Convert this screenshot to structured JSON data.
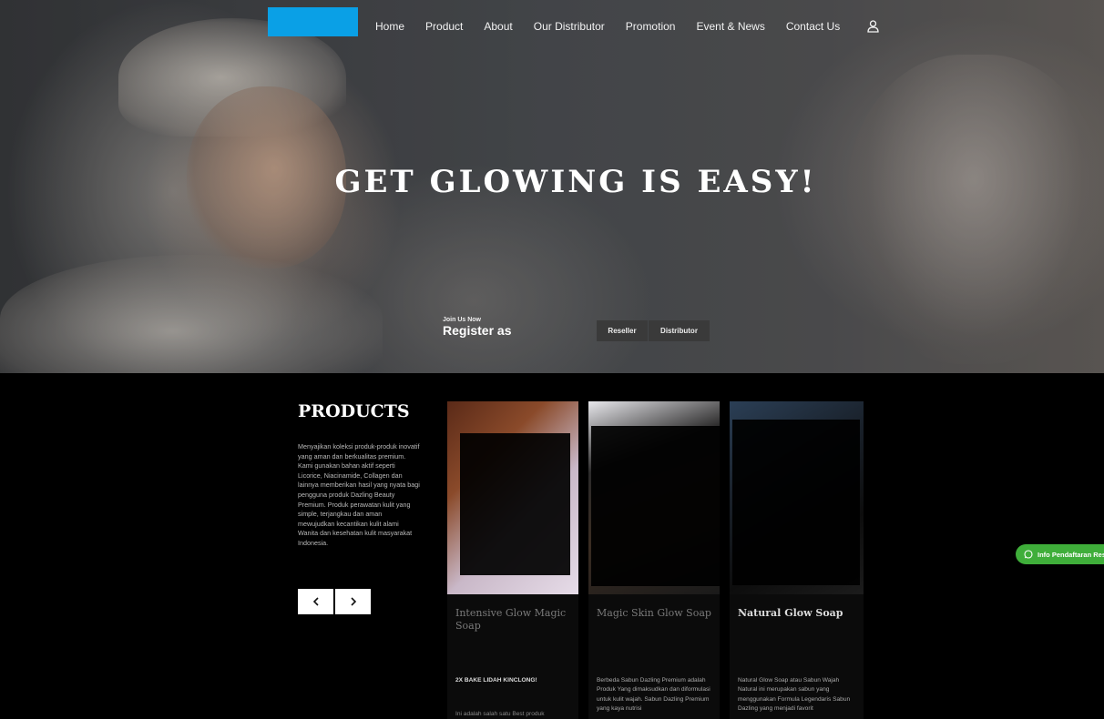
{
  "header": {
    "logo_color": "#0aa0e6",
    "nav": [
      "Home",
      "Product",
      "About",
      "Our Distributor",
      "Promotion",
      "Event & News",
      "Contact Us"
    ],
    "user_icon": "user-icon"
  },
  "hero": {
    "title": "GET GLOWING IS EASY!",
    "join_label": "Join Us Now",
    "register_label": "Register as",
    "buttons": {
      "reseller": "Reseller",
      "distributor": "Distributor"
    }
  },
  "products": {
    "title": "PRODUCTS",
    "description": "Menyajikan koleksi produk-produk inovatif yang aman dan berkualitas premium. Kami gunakan bahan aktif seperti Licorice, Niacinamide, Collagen dan lainnya memberikan hasil yang nyata bagi pengguna produk Dazling Beauty Premium. Produk perawatan kulit yang simple, terjangkau dan aman mewujudkan kecantikan kulit alami Wanita dan kesehatan kulit masyarakat Indonesia.",
    "prev_icon": "chevron-left-icon",
    "next_icon": "chevron-right-icon",
    "cards": [
      {
        "name": "Intensive Glow Magic Soap",
        "text": "2X BAKE LIDAH KINCLONG!",
        "text2": "Ini adalah salah satu Best produk"
      },
      {
        "name": "Magic Skin Glow Soap",
        "text": "Berbeda Sabun Dazling Premium adalah Produk Yang dimaksudkan dan diformulasi untuk kulit wajah. Sabun Dazling Premium yang kaya nutrisi"
      },
      {
        "name": "Natural Glow Soap",
        "text": "Natural Glow Soap atau Sabun Wajah Natural ini merupakan sabun yang menggunakan Formula Legendaris Sabun Dazling yang menjadi favorit"
      }
    ]
  },
  "whatsapp": {
    "label": "Info Pendaftaran Reseller",
    "color": "#3fae3a"
  }
}
